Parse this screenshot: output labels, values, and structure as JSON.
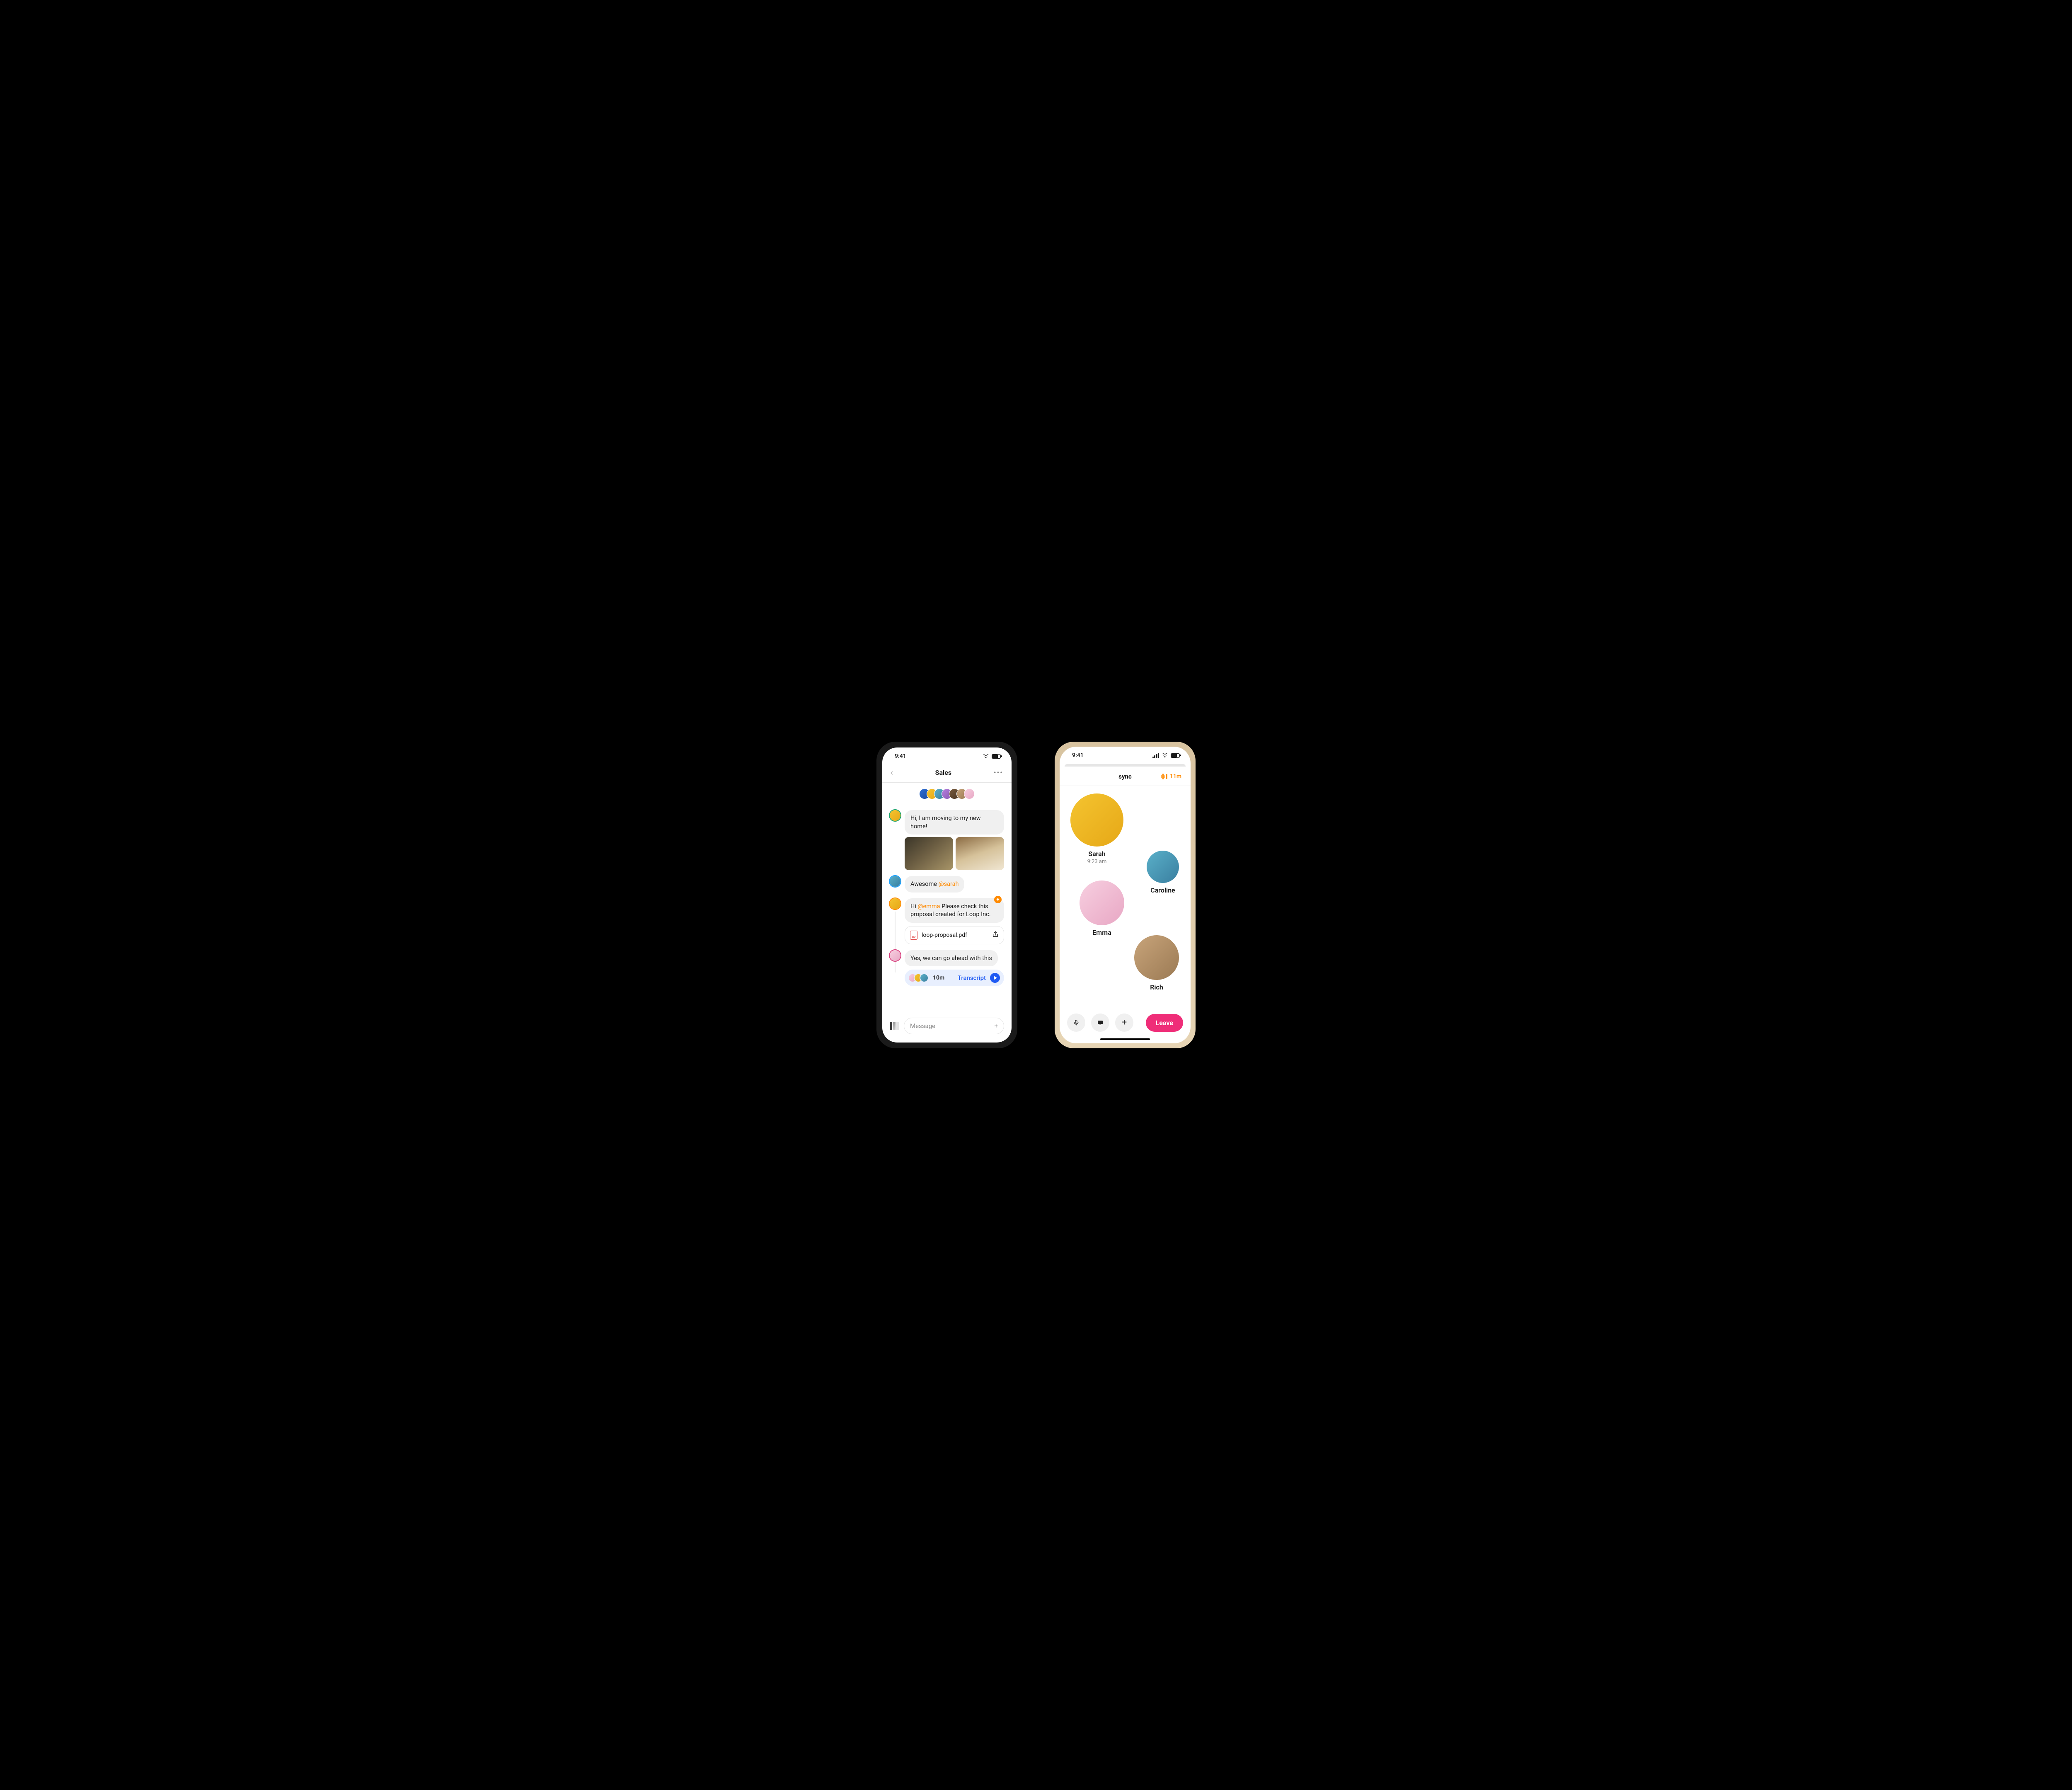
{
  "status": {
    "time": "9:41"
  },
  "chat": {
    "title": "Sales",
    "members_count": 7,
    "msg1": {
      "text": "Hi, I am moving to my new home!"
    },
    "msg2": {
      "prefix": "Awesome ",
      "mention": "@sarah"
    },
    "msg3": {
      "prefix": "Hi ",
      "mention": "@emma",
      "rest": " Please check this proposal created for Loop Inc."
    },
    "file": {
      "name": "loop-proposal.pdf"
    },
    "msg4": {
      "text": "Yes, we can go ahead with this"
    },
    "transcript": {
      "duration": "10m",
      "label": "Transcript"
    },
    "composer": {
      "placeholder": "Message"
    }
  },
  "sync": {
    "title": "sync",
    "timer": "11m",
    "p1": {
      "name": "Sarah",
      "sub": "9:23 am"
    },
    "p2": {
      "name": "Caroline"
    },
    "p3": {
      "name": "Emma"
    },
    "p4": {
      "name": "Rich"
    },
    "leave": "Leave"
  }
}
